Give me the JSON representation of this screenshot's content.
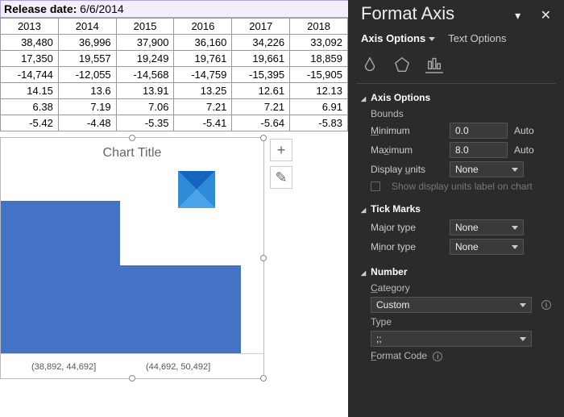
{
  "release": {
    "label": "Release date:",
    "value": "6/6/2014"
  },
  "table": {
    "years": [
      "2013",
      "2014",
      "2015",
      "2016",
      "2017",
      "2018"
    ],
    "rows": [
      [
        "38,480",
        "36,996",
        "37,900",
        "36,160",
        "34,226",
        "33,092"
      ],
      [
        "17,350",
        "19,557",
        "19,249",
        "19,761",
        "19,661",
        "18,859"
      ],
      [
        "-14,744",
        "-12,055",
        "-14,568",
        "-14,759",
        "-15,395",
        "-15,905"
      ],
      [
        "14.15",
        "13.6",
        "13.91",
        "13.25",
        "12.61",
        "12.13"
      ],
      [
        "6.38",
        "7.19",
        "7.06",
        "7.21",
        "7.21",
        "6.91"
      ],
      [
        "-5.42",
        "-4.48",
        "-5.35",
        "-5.41",
        "-5.64",
        "-5.83"
      ]
    ]
  },
  "chart": {
    "title": "Chart Title",
    "x1": "(38,892, 44,692]",
    "x2": "(44,692, 50,492]"
  },
  "side": {
    "plus": "+",
    "brush": "✎"
  },
  "panel": {
    "title": "Format Axis",
    "tab1": "Axis Options",
    "tab2": "Text Options",
    "axisOptions": "Axis Options",
    "bounds": "Bounds",
    "min": "Minimum",
    "minv": "0.0",
    "max": "Maximum",
    "maxv": "8.0",
    "auto": "Auto",
    "displayUnits": "Display units",
    "none": "None",
    "showLbl": "Show display units label on chart",
    "tickMarks": "Tick Marks",
    "major": "Major type",
    "minor": "Minor type",
    "number": "Number",
    "category": "Category",
    "custom": "Custom",
    "type": "Type",
    "typev": ";;",
    "formatCode": "Format Code"
  },
  "chart_data": {
    "type": "bar",
    "categories": [
      "(38,892, 44,692]",
      "(44,692, 50,492]"
    ],
    "values": [
      6.8,
      3.9
    ],
    "title": "Chart Title",
    "xlabel": "",
    "ylabel": "",
    "ylim": [
      0,
      8
    ]
  }
}
